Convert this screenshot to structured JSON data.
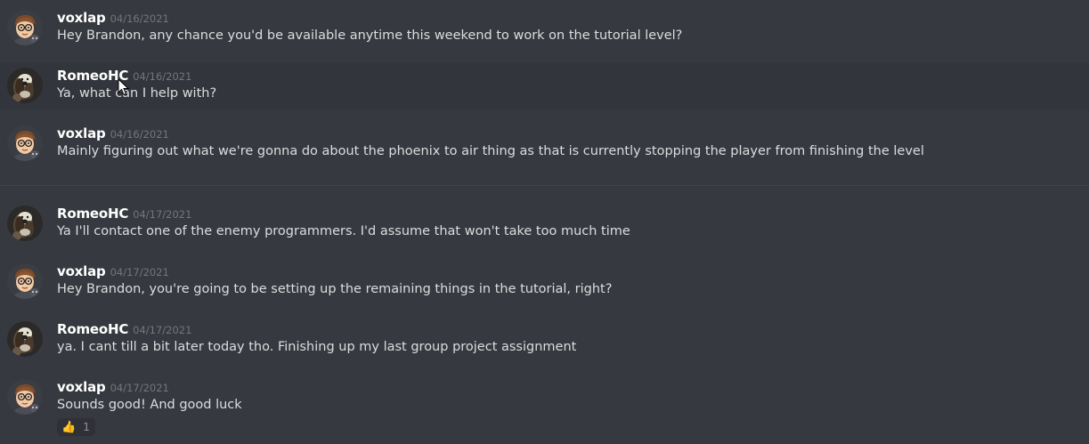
{
  "messages": [
    {
      "author": "voxlap",
      "avatar": "voxlap-avatar",
      "timestamp": "04/16/2021",
      "text": "Hey Brandon, any chance you'd be available anytime this weekend to work on the tutorial level?"
    },
    {
      "author": "RomeoHC",
      "avatar": "romeohc-avatar",
      "timestamp": "04/16/2021",
      "text": "Ya, what can I help with?"
    },
    {
      "author": "voxlap",
      "avatar": "voxlap-avatar",
      "timestamp": "04/16/2021",
      "text": "Mainly figuring out what we're gonna do about the phoenix to air thing as that is currently stopping the player from finishing the level"
    },
    {
      "author": "RomeoHC",
      "avatar": "romeohc-avatar",
      "timestamp": "04/17/2021",
      "text": "Ya I'll contact one of the enemy programmers. I'd assume that won't take too much time"
    },
    {
      "author": "voxlap",
      "avatar": "voxlap-avatar",
      "timestamp": "04/17/2021",
      "text": "Hey Brandon, you're going to be setting up the remaining things in the tutorial, right?"
    },
    {
      "author": "RomeoHC",
      "avatar": "romeohc-avatar",
      "timestamp": "04/17/2021",
      "text": "ya. I cant till a bit later today tho. Finishing up my last group project assignment"
    },
    {
      "author": "voxlap",
      "avatar": "voxlap-avatar",
      "timestamp": "04/17/2021",
      "text": "Sounds good! And good luck"
    }
  ],
  "reaction": {
    "emoji": "👍",
    "icon": "thumbs-up-icon",
    "count": "1"
  },
  "colors": {
    "background": "#36393f",
    "hover_background": "#32353b",
    "username": "#ffffff",
    "timestamp": "#72767d",
    "message_text": "#dcddde",
    "reaction_background": "#2f3136"
  }
}
